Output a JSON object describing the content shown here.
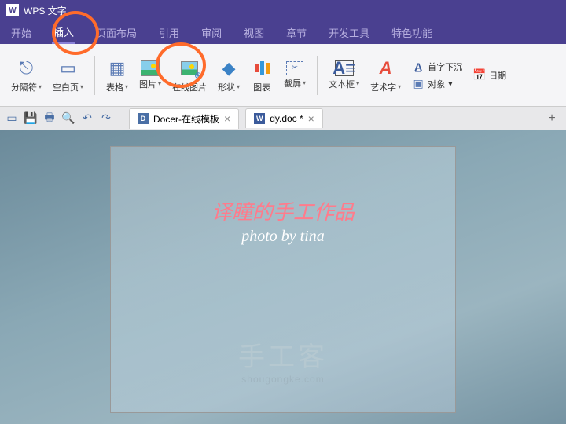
{
  "title_bar": {
    "logo_text": "W",
    "app_name": "WPS 文字"
  },
  "menu": {
    "items": [
      "开始",
      "插入",
      "页面布局",
      "引用",
      "审阅",
      "视图",
      "章节",
      "开发工具",
      "特色功能"
    ],
    "active_index": 1
  },
  "ribbon": {
    "page_break": "分隔符",
    "blank_page": "空白页",
    "table": "表格",
    "picture": "图片",
    "online_picture": "在线图片",
    "shapes": "形状",
    "chart": "图表",
    "screenshot": "截屏",
    "textbox": "文本框",
    "wordart": "艺术字",
    "dropcap": "首字下沉",
    "object": "对象",
    "date": "日期"
  },
  "qat": {
    "new": "新建",
    "save": "保存",
    "print": "打印",
    "preview": "预览",
    "undo": "撤销",
    "redo": "重做"
  },
  "tabs": [
    {
      "icon": "D",
      "label": "Docer-在线模板"
    },
    {
      "icon": "W",
      "label": "dy.doc *"
    }
  ],
  "watermarks": {
    "line1": "译瞳的手工作品",
    "line2": "photo by tina",
    "brand_big": "手工客",
    "brand_small": "shougongke.com"
  }
}
